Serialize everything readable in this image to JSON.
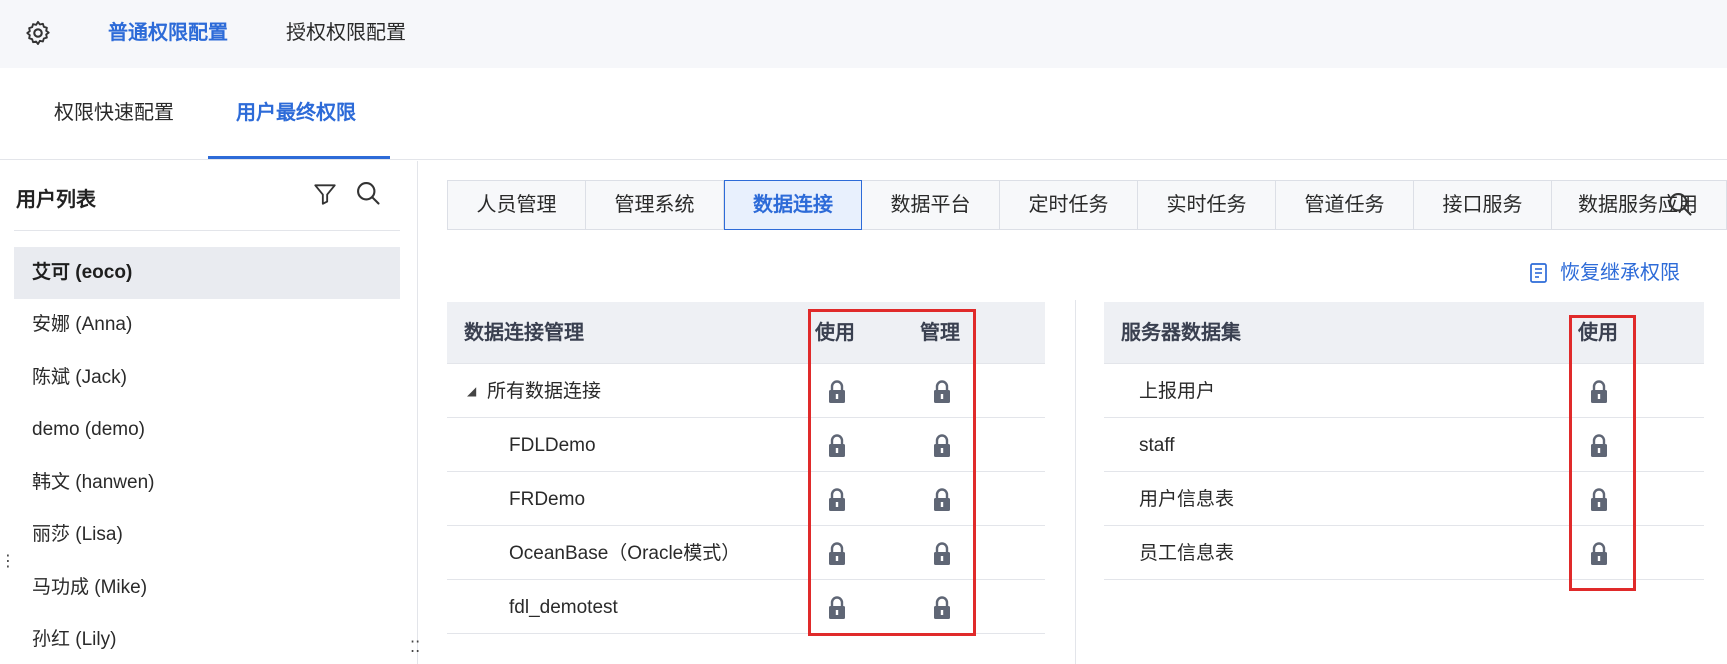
{
  "top_tabs": [
    "普通权限配置",
    "授权权限配置"
  ],
  "sub_tabs": [
    "权限快速配置",
    "用户最终权限"
  ],
  "sidebar": {
    "title": "用户列表",
    "users": [
      "艾可 (eoco)",
      "安娜 (Anna)",
      "陈斌 (Jack)",
      "demo (demo)",
      "韩文 (hanwen)",
      "丽莎 (Lisa)",
      "马功成 (Mike)",
      "孙红 (Lily)"
    ]
  },
  "module_tabs": [
    "人员管理",
    "管理系统",
    "数据连接",
    "数据平台",
    "定时任务",
    "实时任务",
    "管道任务",
    "接口服务",
    "数据服务应用"
  ],
  "restore_label": "恢复继承权限",
  "left_table": {
    "header": "数据连接管理",
    "col_use": "使用",
    "col_manage": "管理",
    "rows": [
      "所有数据连接",
      "FDLDemo",
      "FRDemo",
      "OceanBase（Oracle模式）",
      "fdl_demotest"
    ]
  },
  "right_table": {
    "header": "服务器数据集",
    "col_use": "使用",
    "rows": [
      "上报用户",
      "staff",
      "用户信息表",
      "员工信息表"
    ]
  },
  "colors": {
    "accent": "#2d6bd8",
    "highlight": "#e02a2a",
    "lock": "#5f6675"
  },
  "icons": [
    "gear-icon",
    "filter-icon",
    "search-icon",
    "lock-icon",
    "restore-icon",
    "tree-collapse-icon"
  ]
}
